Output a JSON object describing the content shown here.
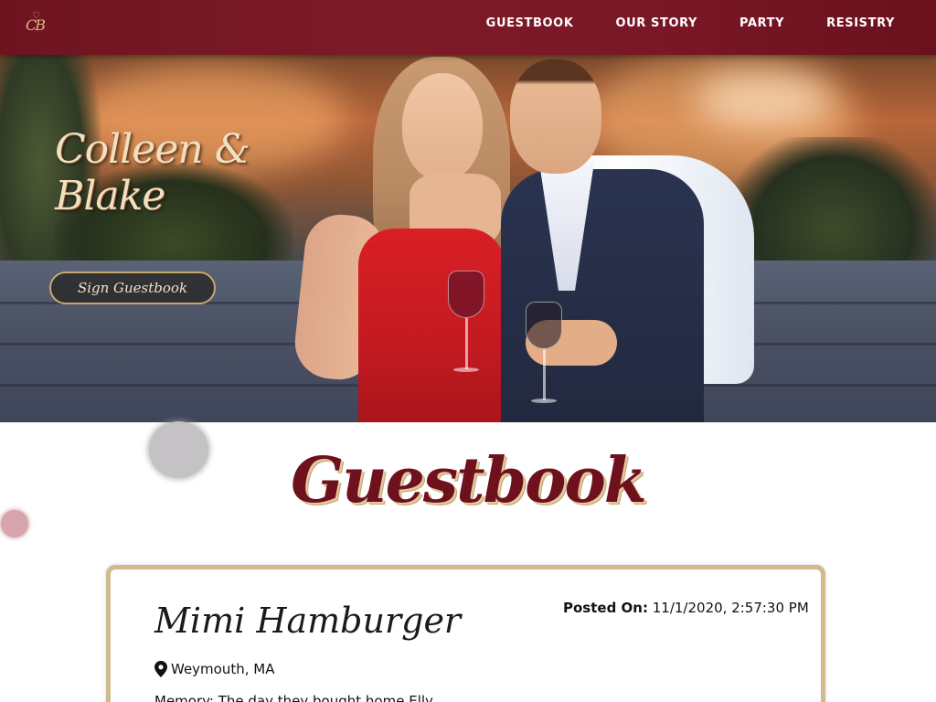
{
  "nav": {
    "logo_text": "CB",
    "links": [
      "GUESTBOOK",
      "OUR STORY",
      "PARTY",
      "RESISTRY"
    ]
  },
  "hero": {
    "title": "Colleen & Blake",
    "cta_label": "Sign Guestbook"
  },
  "guestbook": {
    "heading": "Guestbook",
    "entries": [
      {
        "name": "Mimi Hamburger",
        "posted_label": "Posted On:",
        "posted_value": "11/1/2020, 2:57:30 PM",
        "location": "Weymouth, MA",
        "memory_label": "Memory:",
        "memory_text": "The day they bought home Elly"
      }
    ]
  },
  "colors": {
    "brand_burgundy": "#7a1726",
    "accent_gold": "#cfbb8d"
  },
  "icons": [
    "heart-icon",
    "location-pin-icon"
  ]
}
